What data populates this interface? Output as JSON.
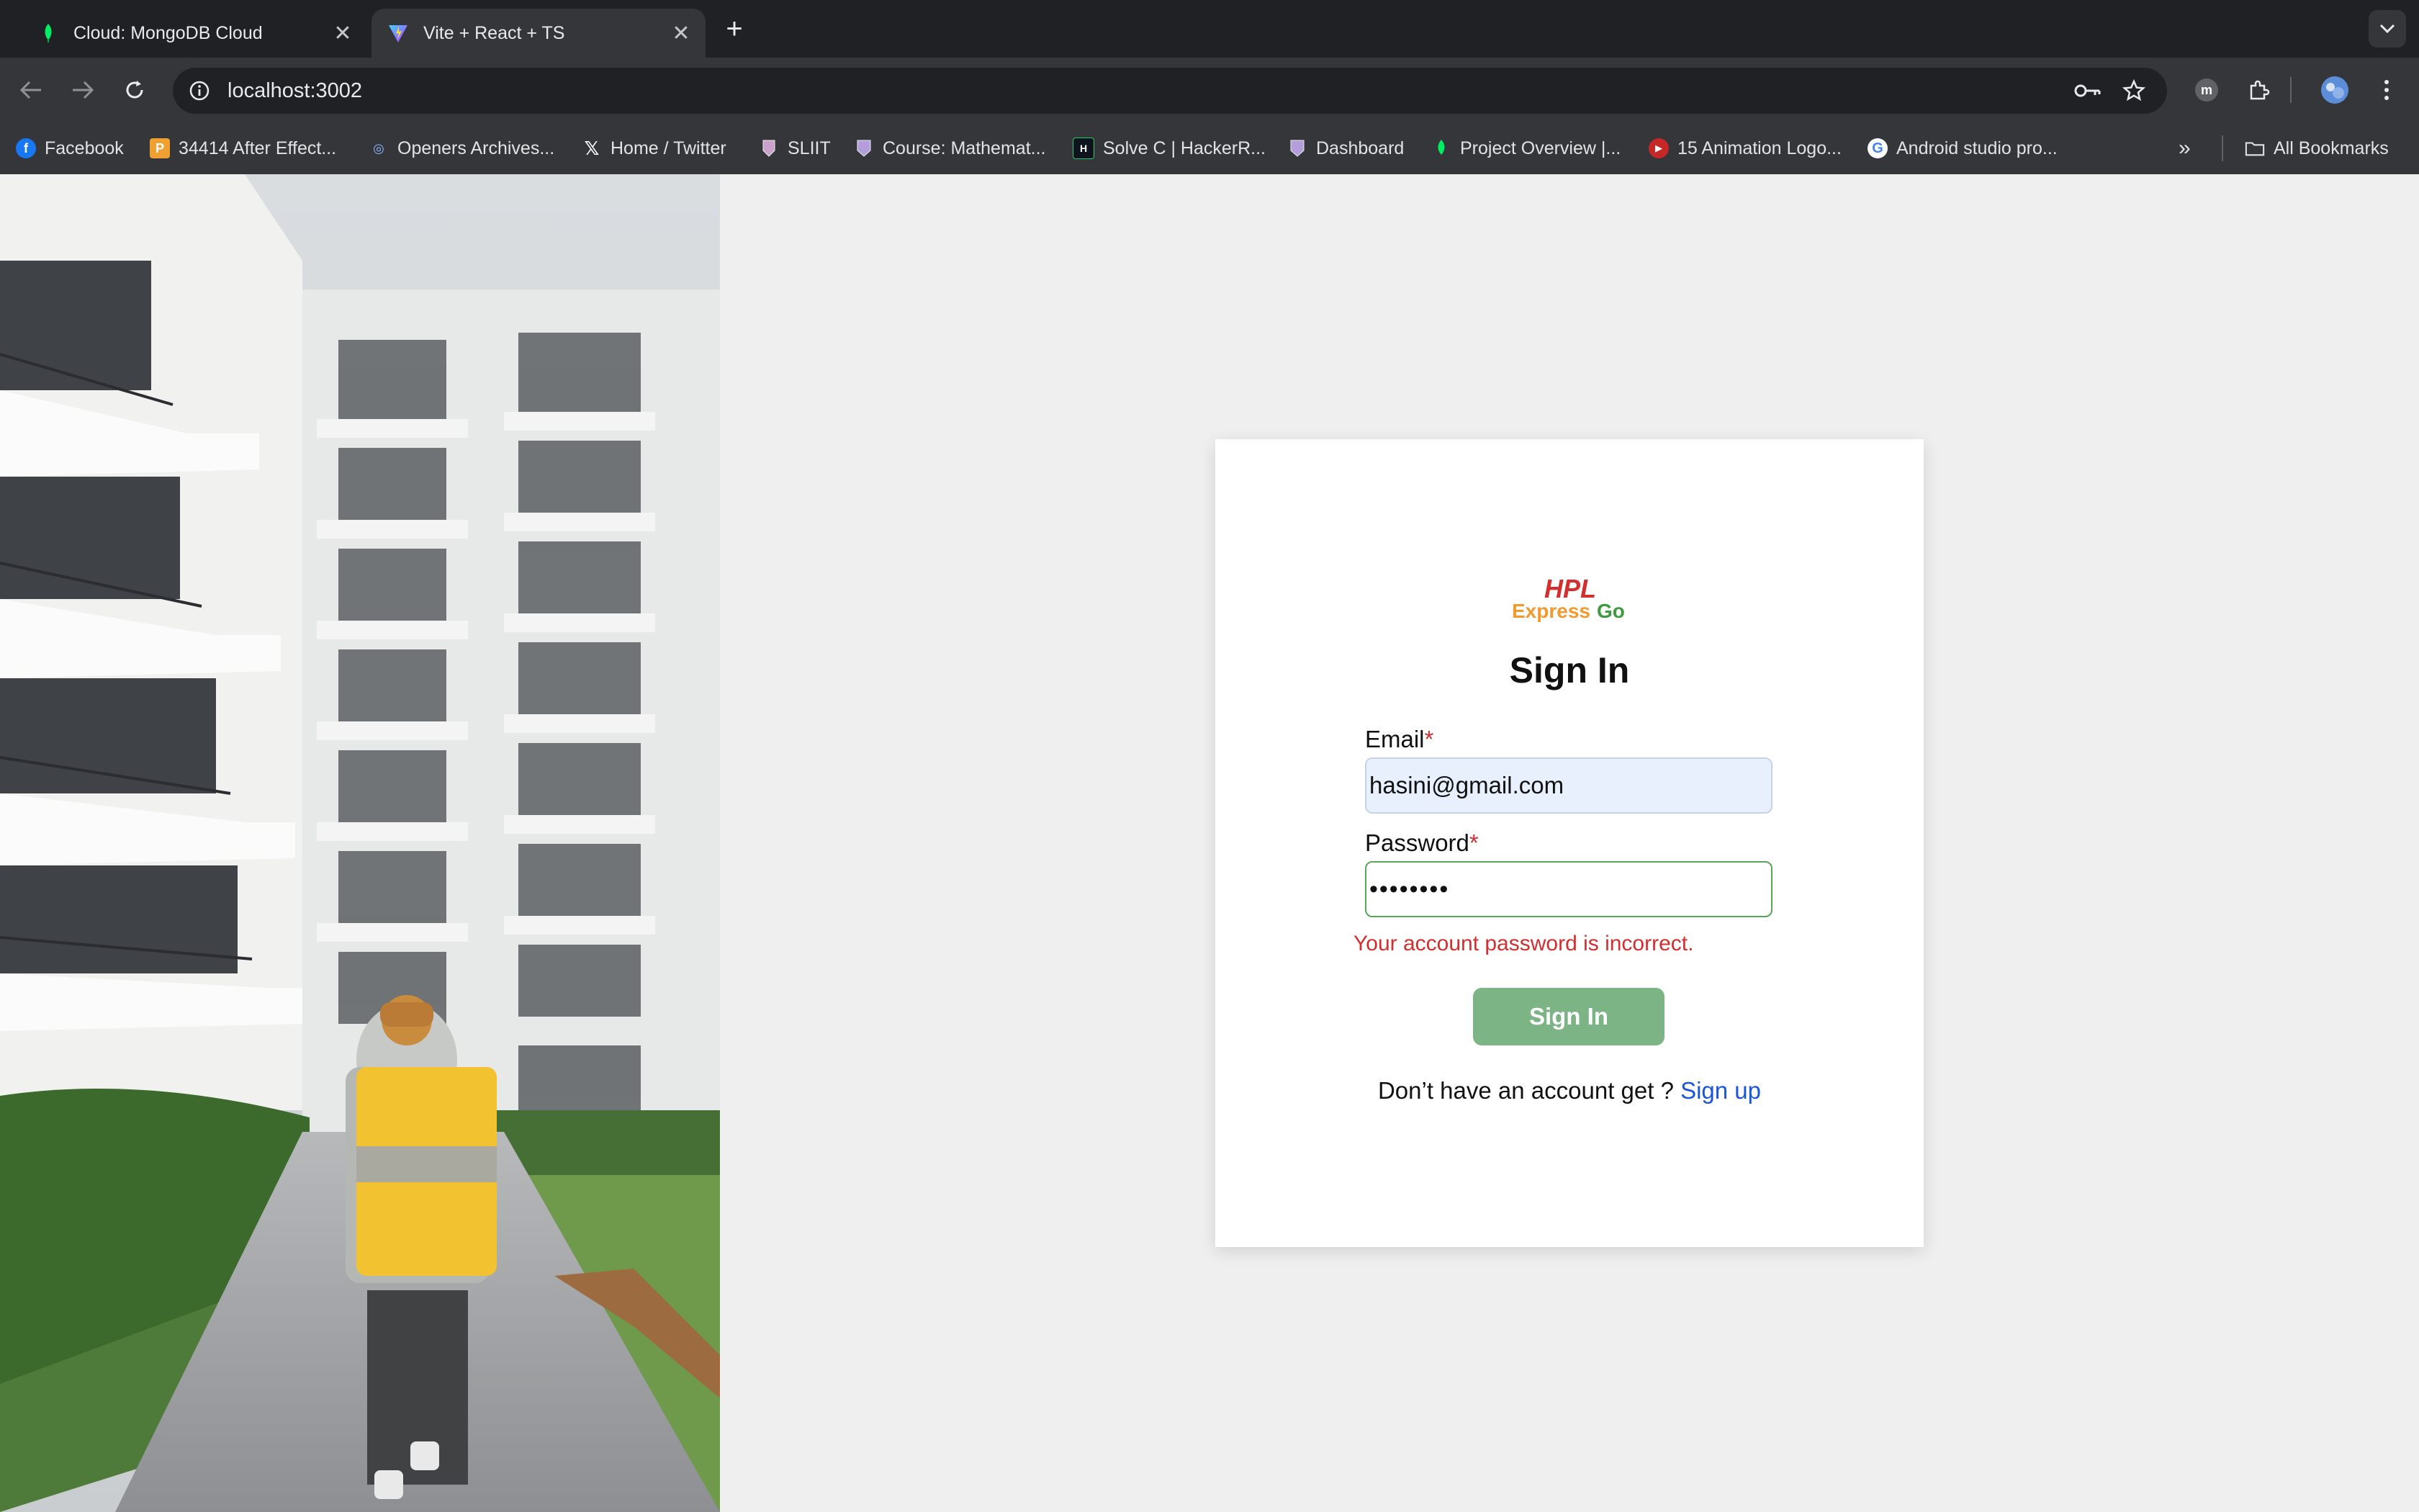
{
  "browser": {
    "tabs": [
      {
        "title": "Cloud: MongoDB Cloud",
        "active": false
      },
      {
        "title": "Vite + React + TS",
        "active": true
      }
    ],
    "url": "localhost:3002",
    "bookmarks": [
      {
        "label": "Facebook",
        "icon": "facebook-icon"
      },
      {
        "label": "34414 After Effect...",
        "icon": "p-icon"
      },
      {
        "label": "Openers Archives...",
        "icon": "site-icon"
      },
      {
        "label": "Home / Twitter",
        "icon": "x-icon"
      },
      {
        "label": "SLIIT",
        "icon": "sliit-icon"
      },
      {
        "label": "Course: Mathemat...",
        "icon": "courseweb-icon"
      },
      {
        "label": "Solve C | HackerR...",
        "icon": "hackerrank-icon"
      },
      {
        "label": "Dashboard",
        "icon": "courseweb-icon"
      },
      {
        "label": "Project Overview |...",
        "icon": "mongodb-icon"
      },
      {
        "label": "15 Animation Logo...",
        "icon": "youtube-icon"
      },
      {
        "label": "Android studio pro...",
        "icon": "google-icon"
      }
    ],
    "all_bookmarks": "All Bookmarks"
  },
  "login": {
    "logo_top": "HPL",
    "logo_express": "Express",
    "logo_go": "Go",
    "title": "Sign In",
    "email_label": "Email",
    "required_mark": "*",
    "email_value": "hasini@gmail.com",
    "password_label": "Password",
    "password_value": "••••••••",
    "error_message": "Your account password is incorrect.",
    "signin_button": "Sign In",
    "signup_prompt": "Don’t have an account get ?",
    "signup_link": "Sign up"
  },
  "colors": {
    "accent_green": "#7db486",
    "error_red": "#d32f2f",
    "link_blue": "#1a56db"
  }
}
